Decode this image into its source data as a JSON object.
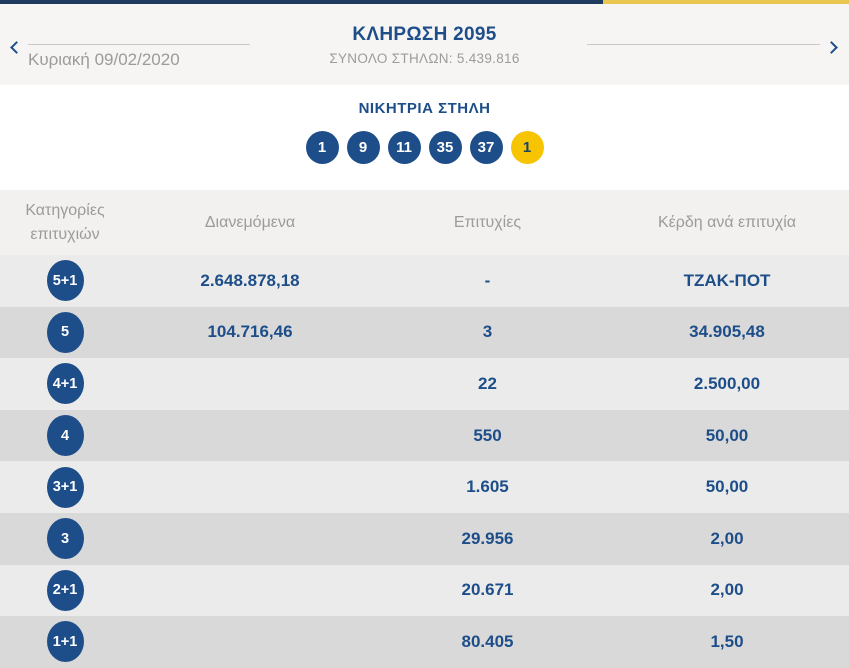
{
  "colors": {
    "brand_blue": "#1d4e89",
    "topbar_blue": "#1e3a5f",
    "topbar_yellow": "#e9c64f",
    "joker_yellow": "#f6c400",
    "muted_gray": "#9b9b9b",
    "row_light": "#ebebeb",
    "row_dark": "#d9d9d9"
  },
  "nav": {
    "prev_icon": "chevron-left",
    "next_icon": "chevron-right"
  },
  "header": {
    "date": "Κυριακή 09/02/2020",
    "title": "ΚΛΗΡΩΣΗ 2095",
    "subtitle": "ΣΥΝΟΛΟ ΣΤΗΛΩΝ: 5.439.816"
  },
  "winning": {
    "title": "ΝΙΚΗΤΡΙΑ ΣΤΗΛΗ",
    "numbers": [
      "1",
      "9",
      "11",
      "35",
      "37"
    ],
    "joker": "1"
  },
  "table": {
    "headers": {
      "categories": "Κατηγορίες επιτυχιών",
      "distributed": "Διανεμόμενα",
      "wins": "Επιτυχίες",
      "prize": "Κέρδη ανά επιτυχία"
    },
    "rows": [
      {
        "badge": "5+1",
        "distributed": "2.648.878,18",
        "wins": "-",
        "prize": "ΤΖΑΚ-ΠΟΤ"
      },
      {
        "badge": "5",
        "distributed": "104.716,46",
        "wins": "3",
        "prize": "34.905,48"
      },
      {
        "badge": "4+1",
        "distributed": "",
        "wins": "22",
        "prize": "2.500,00"
      },
      {
        "badge": "4",
        "distributed": "",
        "wins": "550",
        "prize": "50,00"
      },
      {
        "badge": "3+1",
        "distributed": "",
        "wins": "1.605",
        "prize": "50,00"
      },
      {
        "badge": "3",
        "distributed": "",
        "wins": "29.956",
        "prize": "2,00"
      },
      {
        "badge": "2+1",
        "distributed": "",
        "wins": "20.671",
        "prize": "2,00"
      },
      {
        "badge": "1+1",
        "distributed": "",
        "wins": "80.405",
        "prize": "1,50"
      }
    ]
  }
}
